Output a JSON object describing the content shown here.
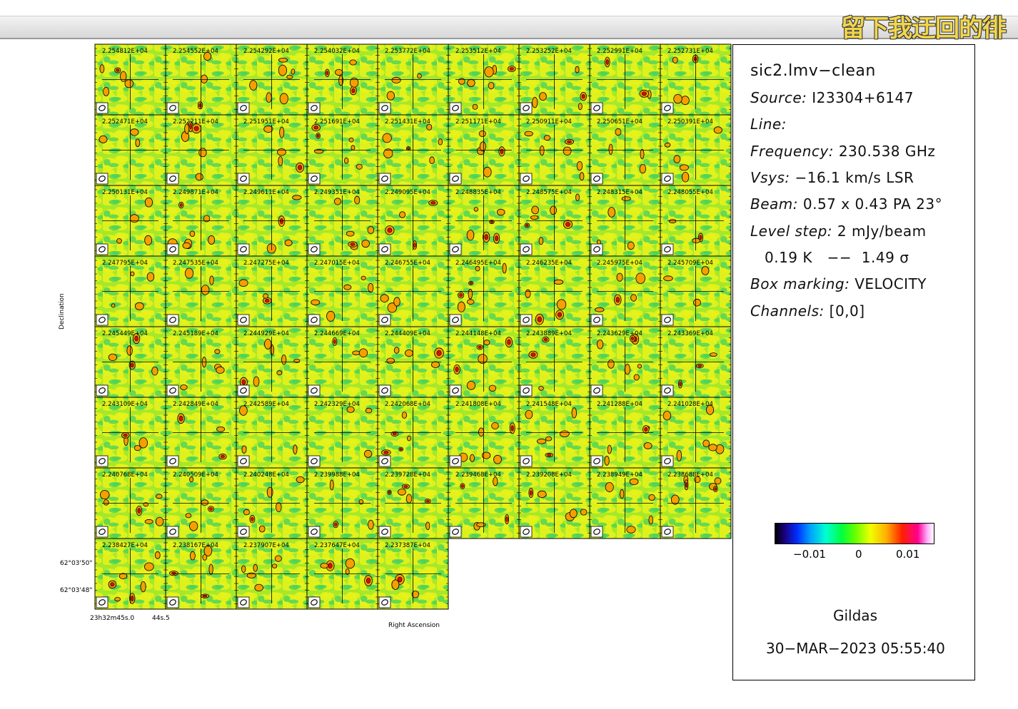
{
  "window": {
    "overlay_text": "留下我迂回的徘"
  },
  "chart_data": {
    "type": "heatmap",
    "description_kind": "channel-map grid",
    "panels": [
      "2.254812E+04",
      "2.254552E+04",
      "2.254292E+04",
      "2.254032E+04",
      "2.253772E+04",
      "2.253512E+04",
      "2.253252E+04",
      "2.252991E+04",
      "2.252731E+04",
      "2.252471E+04",
      "2.252211E+04",
      "2.251951E+04",
      "2.251691E+04",
      "2.251431E+04",
      "2.251171E+04",
      "2.250911E+04",
      "2.250651E+04",
      "2.250391E+04",
      "2.250131E+04",
      "2.249871E+04",
      "2.249611E+04",
      "2.249351E+04",
      "2.249095E+04",
      "2.248835E+04",
      "2.248575E+04",
      "2.248315E+04",
      "2.248055E+04",
      "2.247795E+04",
      "2.247535E+04",
      "2.247275E+04",
      "2.247015E+04",
      "2.246755E+04",
      "2.246495E+04",
      "2.246235E+04",
      "2.245975E+04",
      "2.245709E+04",
      "2.245449E+04",
      "2.245189E+04",
      "2.244929E+04",
      "2.244669E+04",
      "2.244409E+04",
      "2.244148E+04",
      "2.243889E+04",
      "2.243629E+04",
      "2.243369E+04",
      "2.243109E+04",
      "2.242849E+04",
      "2.242589E+04",
      "2.242329E+04",
      "2.242068E+04",
      "2.241808E+04",
      "2.241548E+04",
      "2.241288E+04",
      "2.241028E+04",
      "2.240768E+04",
      "2.240509E+04",
      "2.240248E+04",
      "2.239988E+04",
      "2.239728E+04",
      "2.239468E+04",
      "2.239208E+04",
      "2.238949E+04",
      "2.238688E+04",
      "2.238427E+04",
      "2.238167E+04",
      "2.237907E+04",
      "2.237647E+04",
      "2.237387E+04"
    ],
    "xlabel": "Right Ascension",
    "ylabel": "Declination",
    "dec_ticks": [
      "62°03'50\"",
      "62°03'48\""
    ],
    "ra_ticks": [
      "23h32m45s.0",
      "44s.5"
    ],
    "colorbar": {
      "ticks": [
        "−0.01",
        "0",
        "0.01"
      ]
    }
  },
  "info": {
    "title": "sic2.lmv−clean",
    "source_key": "Source:",
    "source_val": "I23304+6147",
    "line_key": "Line:",
    "line_val": "",
    "freq_key": "Frequency:",
    "freq_val": "230.538 GHz",
    "vsys_key": "Vsys:",
    "vsys_val": "−16.1 km/s LSR",
    "beam_key": "Beam:",
    "beam_val": "0.57 x 0.43 PA 23°",
    "level_key": "Level step:",
    "level_val": "2 mJy/beam",
    "level2": "0.19 K   −−  1.49 σ",
    "box_key": "Box marking:",
    "box_val": "VELOCITY",
    "chan_key": "Channels:",
    "chan_val": "[0,0]",
    "program": "Gildas",
    "timestamp": "30−MAR−2023 05:55:40"
  }
}
